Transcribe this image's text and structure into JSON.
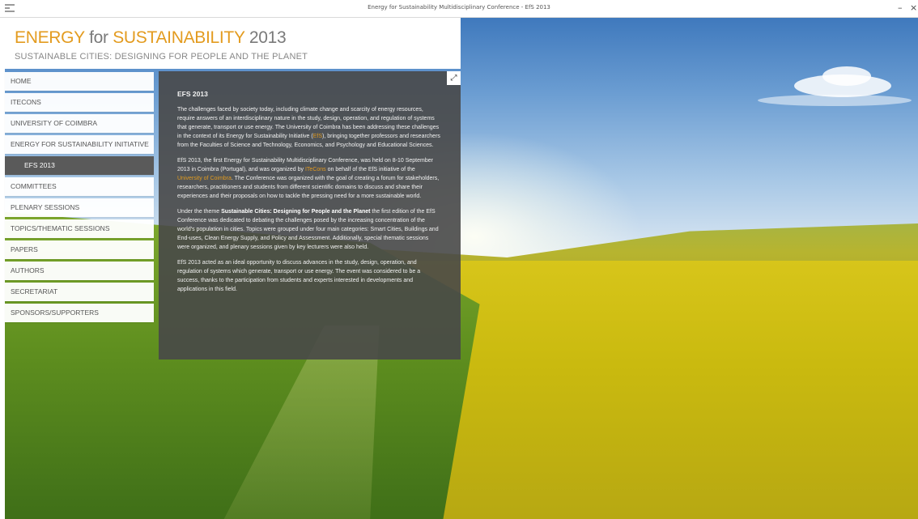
{
  "window": {
    "title": "Energy for Sustainability Multidisciplinary Conference - EfS 2013",
    "minimize": "–",
    "close": "×"
  },
  "header": {
    "title_part1": "ENERGY",
    "title_part2": "for",
    "title_part3": "SUSTAINABILITY",
    "title_part4": "2013",
    "subtitle": "SUSTAINABLE CITIES: DESIGNING FOR PEOPLE AND THE PLANET"
  },
  "nav": {
    "items": [
      {
        "label": "HOME"
      },
      {
        "label": "ITECONS"
      },
      {
        "label": "UNIVERSITY OF COIMBRA"
      },
      {
        "label": "ENERGY FOR SUSTAINABILITY INITIATIVE"
      },
      {
        "label": "EFS 2013"
      },
      {
        "label": "COMMITTEES"
      },
      {
        "label": "PLENARY SESSIONS"
      },
      {
        "label": "TOPICS/THEMATIC SESSIONS"
      },
      {
        "label": "PAPERS"
      },
      {
        "label": "AUTHORS"
      },
      {
        "label": "SECRETARIAT"
      },
      {
        "label": "SPONSORS/SUPPORTERS"
      }
    ],
    "active_index": 4
  },
  "content": {
    "expand_icon": "⤢",
    "title": "EFS 2013",
    "p1_a": "The challenges faced by society today, including climate change and scarcity of energy resources, require answers of an interdisciplinary nature in the study, design, operation, and regulation of systems that generate, transport or use energy. The University of Coimbra has been addressing these challenges in the context of its Energy for Sustainability Initiative (",
    "p1_link": "EfS",
    "p1_b": "), bringing together professors and researchers from the Faculties of Science and Technology, Economics, and Psychology and Educational Sciences.",
    "p2_a": "EfS 2013, the first Energy for Sustainability Multidisciplinary Conference, was held on 8-10 September 2013 in Coimbra (Portugal), and was organized by ",
    "p2_link1": "ITeCons",
    "p2_b": " on behalf of the EfS initiative of the ",
    "p2_link2": "University of Coimbra",
    "p2_c": ". The Conference was organized with the goal of creating a forum for stakeholders, researchers, practitioners and students from different scientific domains to discuss and share their experiences and their proposals on how to tackle the pressing need for a more sustainable world.",
    "p3_a": "Under the theme ",
    "p3_bold": "Sustainable Cities: Designing for People and the Planet",
    "p3_b": " the first edition of the EfS Conference was dedicated to debating the challenges posed by the increasing concentration of the world's population in cities. Topics were grouped under four main categories: Smart Cities, Buildings and End-uses, Clean Energy Supply, and Policy and Assessment. Additionally, special thematic sessions were organized, and plenary sessions given by key lecturers were also held.",
    "p4": "EfS 2013 acted as an ideal opportunity to discuss advances in the study, design, operation, and regulation of systems which generate, transport or use energy. The event was considered to be a success, thanks to the participation from students and experts interested in developments and applications in this field."
  },
  "colors": {
    "accent": "#e39b1f",
    "panel": "#484848",
    "active_nav": "#5a5a5a"
  }
}
